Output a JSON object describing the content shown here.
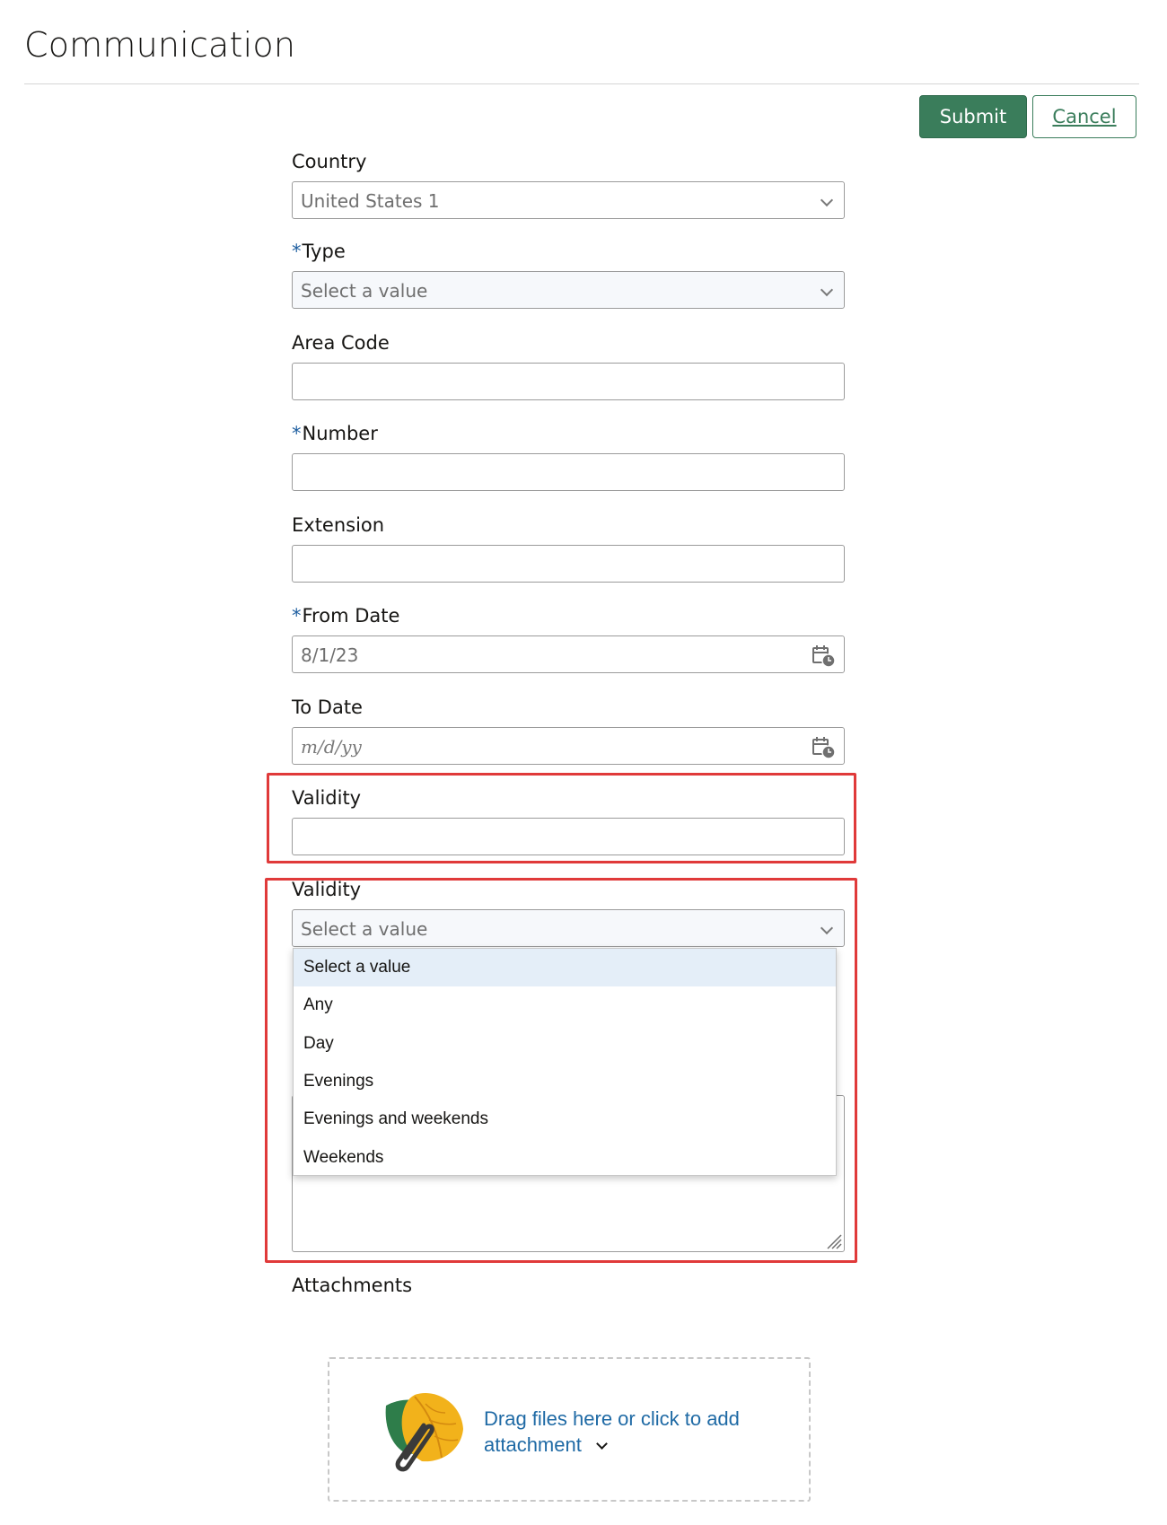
{
  "page": {
    "title": "Communication"
  },
  "actions": {
    "submit_label": "Submit",
    "cancel_label": "Cancel"
  },
  "form": {
    "country": {
      "label": "Country",
      "value": "United States 1"
    },
    "type": {
      "required": "*",
      "label": "Type",
      "value": "Select a value"
    },
    "area_code": {
      "label": "Area Code",
      "value": ""
    },
    "number": {
      "required": "*",
      "label": "Number",
      "value": ""
    },
    "extension": {
      "label": "Extension",
      "value": ""
    },
    "from_date": {
      "required": "*",
      "label": "From Date",
      "value": "8/1/23"
    },
    "to_date": {
      "label": "To Date",
      "placeholder": "m/d/yy"
    },
    "validity_text": {
      "label": "Validity",
      "value": ""
    },
    "validity_select": {
      "label": "Validity",
      "value": "Select a value",
      "options": [
        "Select a value",
        "Any",
        "Day",
        "Evenings",
        "Evenings and weekends",
        "Weekends"
      ],
      "highlighted_index": 0
    }
  },
  "attachments": {
    "label": "Attachments",
    "drop_text_line1": "Drag files here or click to add",
    "drop_text_line2": "attachment"
  },
  "colors": {
    "accent": "#3a7d5b",
    "highlight": "#e03a3a",
    "link": "#1f6aa5",
    "required": "#1f5fa0"
  }
}
